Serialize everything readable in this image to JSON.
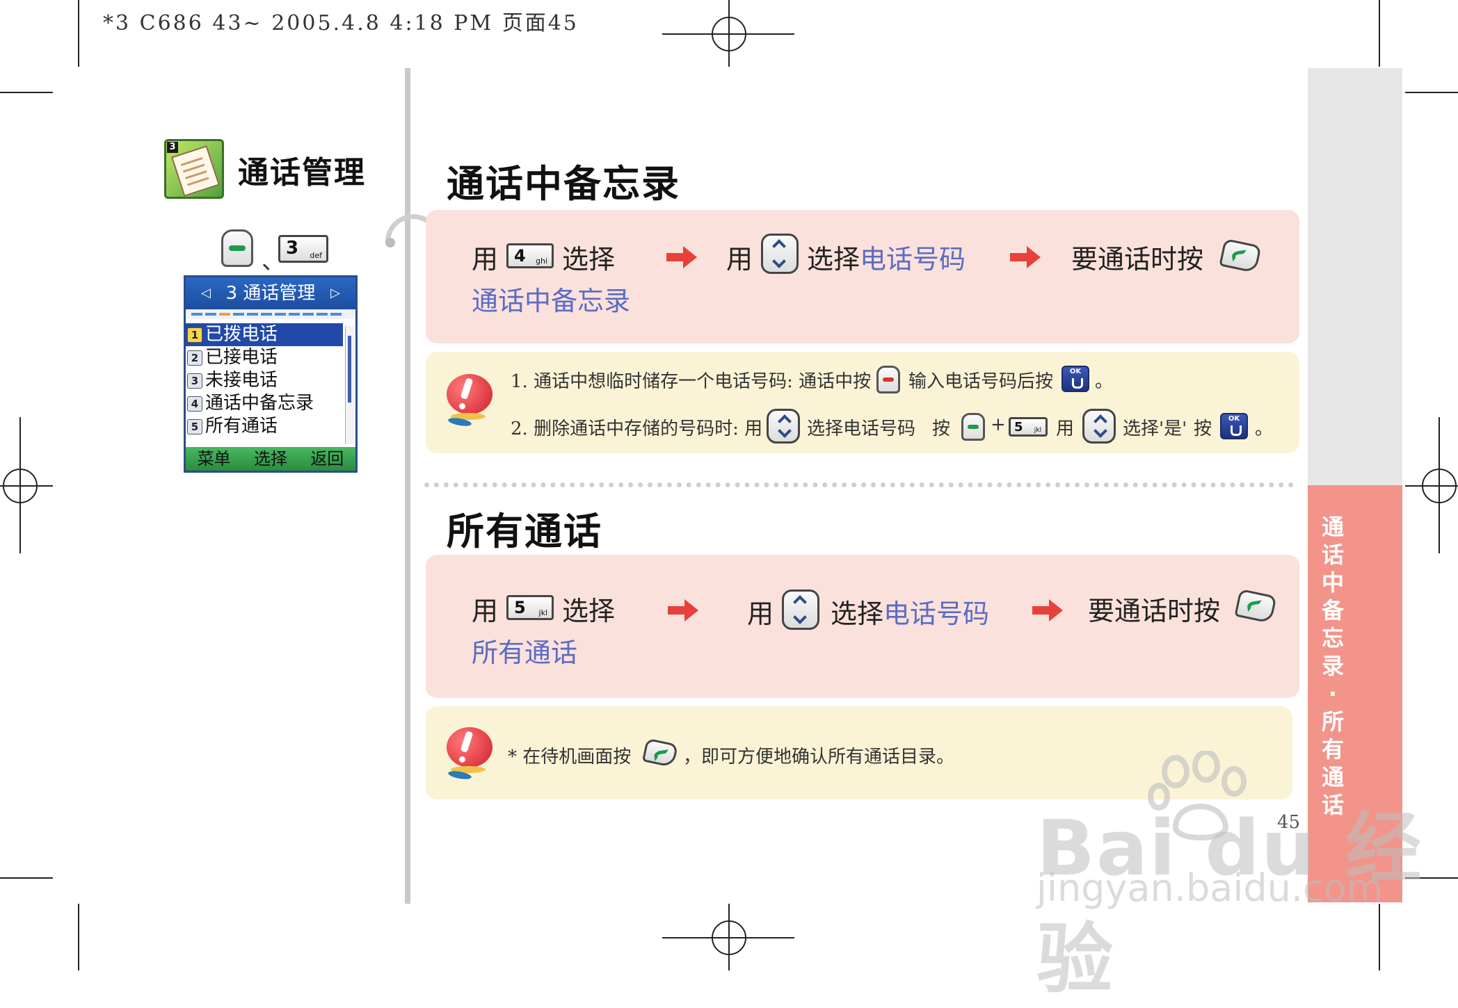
{
  "print_header": "*3 C686 43~ 2005.4.8 4:18 PM 页面45",
  "sidebar": {
    "app_title": "通话管理",
    "key_separator": "、",
    "key3": {
      "num": "3",
      "sub": "def"
    },
    "phone_screen": {
      "title": "3 通话管理",
      "items": [
        {
          "num": "1",
          "label": "已拨电话",
          "selected": true
        },
        {
          "num": "2",
          "label": "已接电话",
          "selected": false
        },
        {
          "num": "3",
          "label": "未接电话",
          "selected": false
        },
        {
          "num": "4",
          "label": "通话中备忘录",
          "selected": false
        },
        {
          "num": "5",
          "label": "所有通话",
          "selected": false
        }
      ],
      "softkeys": [
        "菜单",
        "选择",
        "返回"
      ]
    }
  },
  "section1": {
    "title": "通话中备忘录",
    "step1_use": "用",
    "step1_key": {
      "num": "4",
      "sub": "ghi"
    },
    "step1_select": "选择",
    "step1_target": "通话中备忘录",
    "step2_use": "用",
    "step2_select": "选择",
    "step2_target": "电话号码",
    "step3": "要通话时按",
    "notes": {
      "n1_a": "1. 通话中想临时储存一个电话号码: 通话中按",
      "n1_b": "输入电话号码后按",
      "n1_end": "。",
      "n2_a": "2. 删除通话中存储的号码时: 用",
      "n2_b": "选择电话号码",
      "n2_c": "按",
      "n2_plus": "+",
      "n2_key": {
        "num": "5",
        "sub": "jkl"
      },
      "n2_d": "用",
      "n2_e": "选择'是'",
      "n2_f": "按",
      "n2_end": "。"
    }
  },
  "section2": {
    "title": "所有通话",
    "step1_use": "用",
    "step1_key": {
      "num": "5",
      "sub": "jkl"
    },
    "step1_select": "选择",
    "step1_target": "所有通话",
    "step2_use": "用",
    "step2_select": "选择",
    "step2_target": "电话号码",
    "step3": "要通话时按",
    "note_a": "* 在待机画面按",
    "note_b": "，即可方便地确认所有通话目录。"
  },
  "side_tab": "通话中备忘录 · 所有通话",
  "page_number": "45",
  "ok_label": "OK",
  "watermark": {
    "main": "Bai du 经验",
    "sub": "jingyan.baidu.com"
  },
  "colors": {
    "pink_box": "#fbe1db",
    "yellow_box": "#fbf3d6",
    "highlight": "#5a6cc4",
    "tab_pink": "#f2948a",
    "arrow_red": "#e8403a"
  }
}
